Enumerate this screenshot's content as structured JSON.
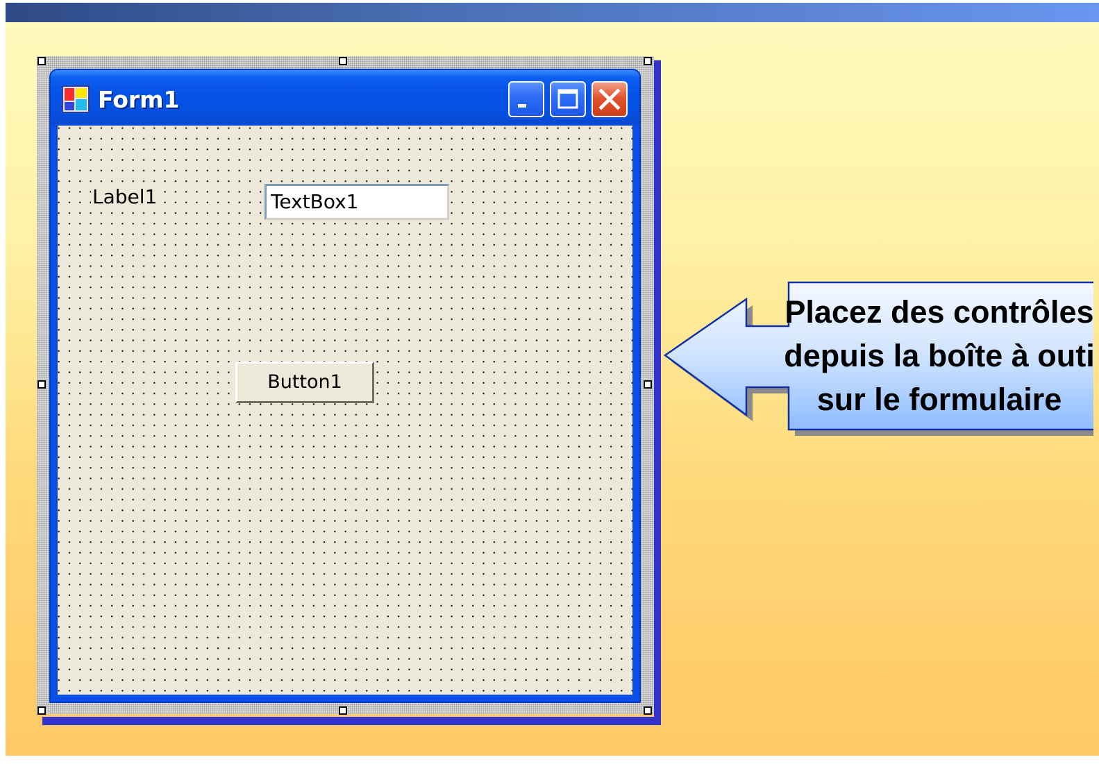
{
  "form": {
    "title": "Form1",
    "label": "Label1",
    "textbox_value": "TextBox1",
    "button_label": "Button1"
  },
  "callout": {
    "lines": [
      "Placez des contrôles",
      "depuis la boîte à outi",
      "sur le formulaire"
    ]
  },
  "colors": {
    "titlebar": "#0553e6",
    "client": "#ece9d8",
    "close_button": "#e1532f",
    "callout_fill": "#a6ceff"
  },
  "icons": {
    "app": "form-app-icon",
    "minimize": "minimize-icon",
    "maximize": "maximize-icon",
    "close": "close-icon",
    "callout": "left-arrow-callout"
  }
}
